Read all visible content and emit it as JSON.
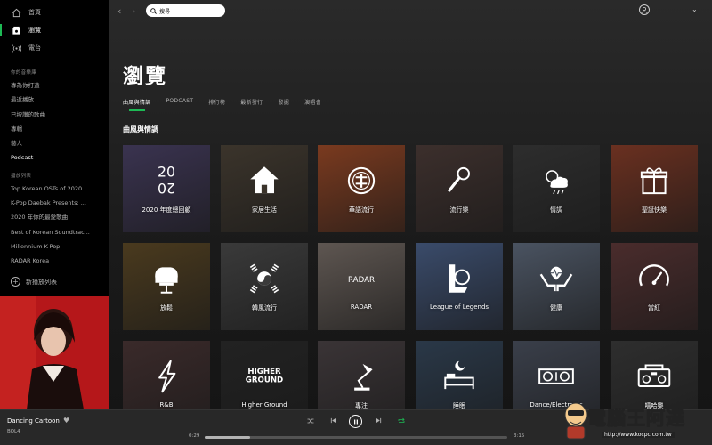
{
  "sidebar": {
    "nav": [
      {
        "label": "首頁",
        "icon": "home-icon"
      },
      {
        "label": "瀏覽",
        "icon": "browse-icon"
      },
      {
        "label": "電台",
        "icon": "radio-icon"
      }
    ],
    "library_heading": "你的音樂庫",
    "library": [
      "專為你打造",
      "最近播放",
      "已按讚的歌曲",
      "專輯",
      "藝人",
      "Podcast"
    ],
    "playlists_heading": "播放列表",
    "playlists": [
      "Top Korean OSTs of 2020",
      "K-Pop Daebak Presents: ...",
      "2020 年你的最愛歌曲",
      "Best of Korean Soundtrac...",
      "Millennium K-Pop",
      "RADAR Korea"
    ],
    "new_playlist": "新播放列表"
  },
  "topbar": {
    "search_placeholder": "搜尋",
    "search_value": "搜尋"
  },
  "page": {
    "title": "瀏覽",
    "tabs": [
      "曲風與情調",
      "PODCAST",
      "排行榜",
      "最新發行",
      "發掘",
      "演唱會"
    ],
    "active_tab": 0,
    "section": "曲風與情調"
  },
  "tiles": [
    {
      "label": "2020 年度總回顧",
      "icon": "2020-icon",
      "color": "#3a3350"
    },
    {
      "label": "家居生活",
      "icon": "home-icon",
      "color": "#3b342b"
    },
    {
      "label": "華語流行",
      "icon": "chinese-emblem-icon",
      "color": "#7a3a1f"
    },
    {
      "label": "流行樂",
      "icon": "microphone-icon",
      "color": "#3c2f2c"
    },
    {
      "label": "情調",
      "icon": "mood-weather-icon",
      "color": "#2d2d2d"
    },
    {
      "label": "聖誕快樂",
      "icon": "gift-icon",
      "color": "#6a3020"
    },
    {
      "label": "放鬆",
      "icon": "armchair-icon",
      "color": "#4a3a1e"
    },
    {
      "label": "韓風流行",
      "icon": "korean-flag-icon",
      "color": "#3a3a3a"
    },
    {
      "label": "RADAR",
      "icon": "radar-text-icon",
      "color": "#5e5651"
    },
    {
      "label": "League of Legends",
      "icon": "lol-logo-icon",
      "color": "#3a4b6a"
    },
    {
      "label": "健康",
      "icon": "health-hands-icon",
      "color": "#4a5361"
    },
    {
      "label": "當紅",
      "icon": "gauge-icon",
      "color": "#4a2c2c"
    },
    {
      "label": "R&B",
      "icon": "lightning-icon",
      "color": "#3a2a2a"
    },
    {
      "label": "Higher Ground",
      "icon": "higher-ground-icon",
      "color": "#222222"
    },
    {
      "label": "專注",
      "icon": "desk-lamp-icon",
      "color": "#3a3436"
    },
    {
      "label": "睡眠",
      "icon": "bed-moon-icon",
      "color": "#2a3848"
    },
    {
      "label": "Dance/Electronic",
      "icon": "turntables-icon",
      "color": "#3a3f4a"
    },
    {
      "label": "嘻哈樂",
      "icon": "boombox-icon",
      "color": "#2e2e2e"
    }
  ],
  "player": {
    "track": "Dancing Cartoon",
    "artist": "BOL4",
    "elapsed": "0:29",
    "duration": "3:15",
    "progress": 0.15
  },
  "watermark": {
    "text": "電腦王阿達",
    "url": "http://www.kocpc.com.tw"
  }
}
